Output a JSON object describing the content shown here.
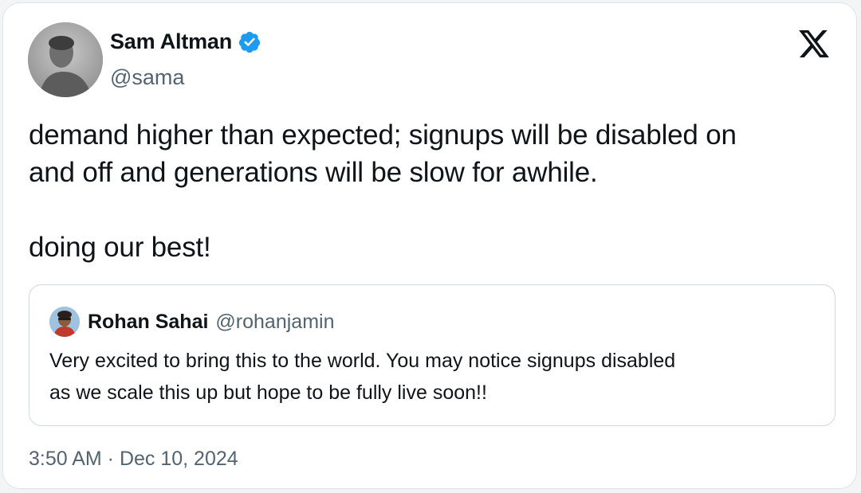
{
  "author": {
    "name": "Sam Altman",
    "handle": "@sama",
    "verified": true,
    "avatar_icon": "profile-photo"
  },
  "post": {
    "lines": [
      "demand higher than expected; signups will be disabled on",
      "and off and generations will be slow for awhile.",
      "doing our best!"
    ]
  },
  "quoted_post": {
    "name": "Rohan Sahai",
    "handle": "@rohanjamin",
    "lines": [
      "Very excited to bring this to the world. You may notice signups disabled",
      "as we scale this up but hope to be fully live soon!!"
    ]
  },
  "timestamp": "3:50 AM · Dec 10, 2024",
  "platform_icon": "x-logo",
  "colors": {
    "verified_blue": "#1d9bf0",
    "secondary_text": "#536471",
    "border": "#cfd9de"
  }
}
